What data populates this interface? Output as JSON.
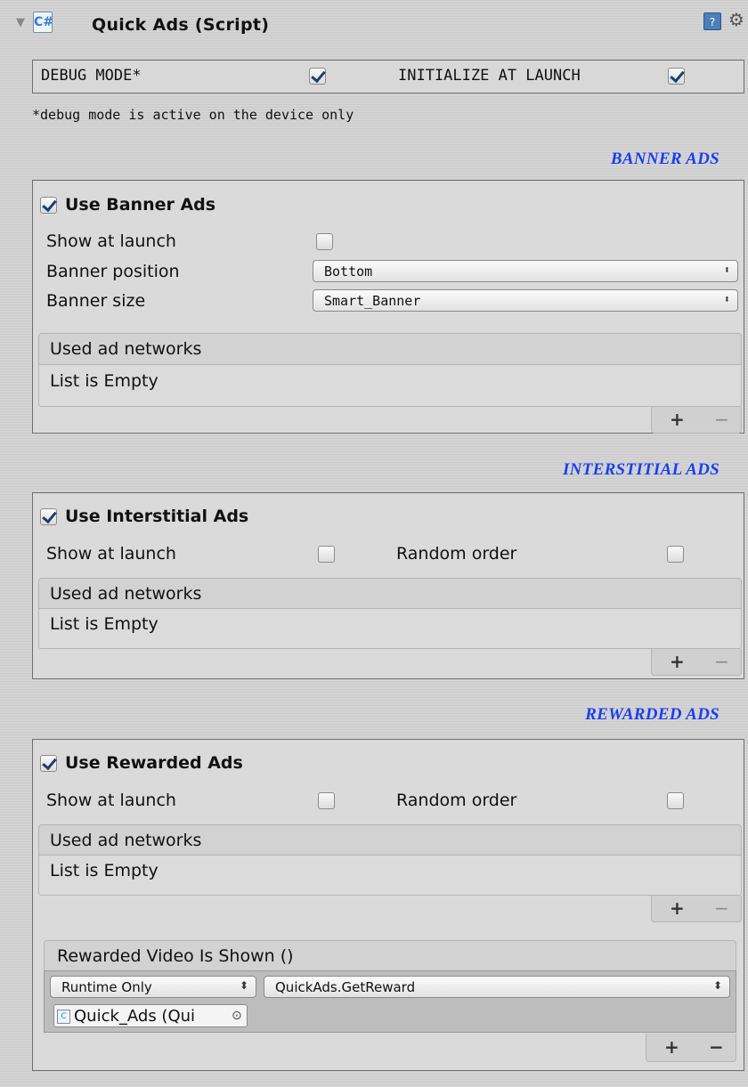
{
  "header": {
    "fold_icon": "triangle-down",
    "script_icon": "script-icon",
    "script_icon_glyph": "C#",
    "title": "Quick Ads (Script)",
    "help_icon": "help-icon",
    "gear_icon": "gear-icon"
  },
  "debug_row": {
    "debug_label": "DEBUG MODE*",
    "debug_checked": true,
    "init_label": "INITIALIZE AT LAUNCH",
    "init_checked": true,
    "note": "*debug mode is active on the device only"
  },
  "banner": {
    "section_title": "BANNER ADS",
    "use_label": "Use Banner Ads",
    "use_checked": true,
    "show_at_launch_label": "Show at launch",
    "show_at_launch_checked": false,
    "position_label": "Banner position",
    "position_value": "Bottom",
    "size_label": "Banner size",
    "size_value": "Smart_Banner",
    "networks_header": "Used ad networks",
    "networks_empty": "List is Empty",
    "add_label": "+",
    "remove_label": "−"
  },
  "interstitial": {
    "section_title": "INTERSTITIAL ADS",
    "use_label": "Use Interstitial Ads",
    "use_checked": true,
    "show_at_launch_label": "Show at launch",
    "show_at_launch_checked": false,
    "random_order_label": "Random order",
    "random_order_checked": false,
    "networks_header": "Used ad networks",
    "networks_empty": "List is Empty",
    "add_label": "+",
    "remove_label": "−"
  },
  "rewarded": {
    "section_title": "REWARDED ADS",
    "use_label": "Use Rewarded Ads",
    "use_checked": true,
    "show_at_launch_label": "Show at launch",
    "show_at_launch_checked": false,
    "random_order_label": "Random order",
    "random_order_checked": false,
    "networks_header": "Used ad networks",
    "networks_empty": "List is Empty",
    "add_label": "+",
    "remove_label": "−",
    "event": {
      "header": "Rewarded Video Is Shown ()",
      "runtime_value": "Runtime Only",
      "function_value": "QuickAds.GetReward",
      "object_value": "Quick_Ads (Qui",
      "add_label": "+",
      "remove_label": "−"
    }
  }
}
